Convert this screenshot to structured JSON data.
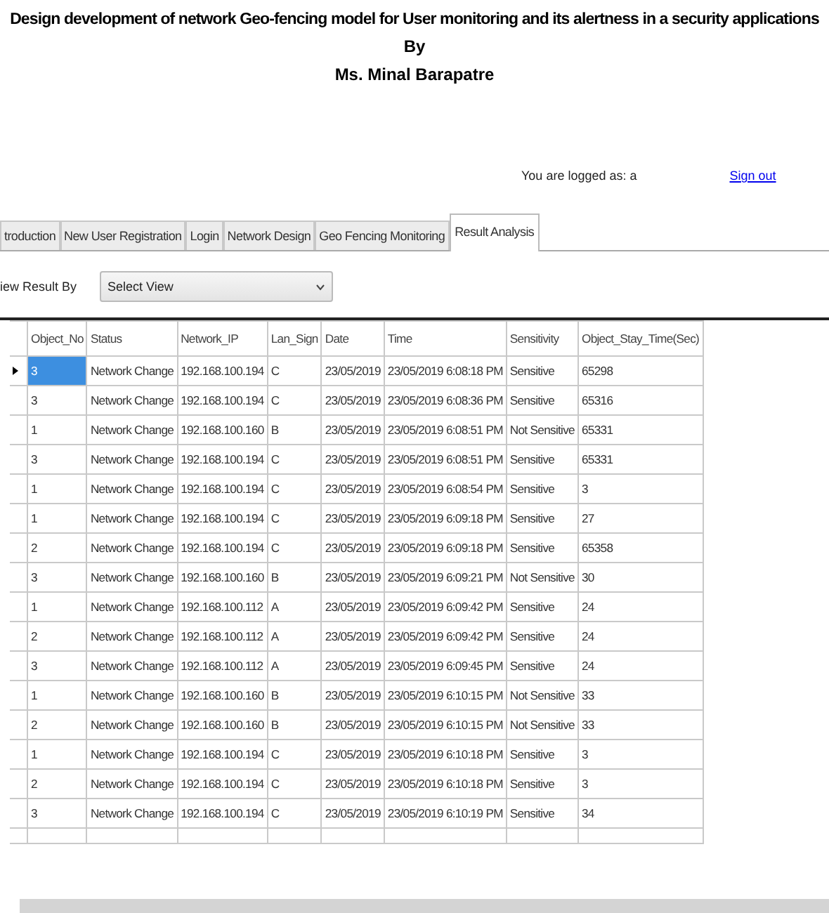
{
  "header": {
    "title": "Design  development of network Geo-fencing model for User monitoring and its alertness in a security applications",
    "by": "By",
    "author": "Ms. Minal Barapatre"
  },
  "user_bar": {
    "logged_as": "You are logged as: a",
    "sign_out": "Sign out"
  },
  "tabs": [
    {
      "label": "troduction",
      "selected": false
    },
    {
      "label": "New User Registration",
      "selected": false
    },
    {
      "label": "Login",
      "selected": false
    },
    {
      "label": "Network Design",
      "selected": false
    },
    {
      "label": "Geo Fencing Monitoring",
      "selected": false
    },
    {
      "label": "Result Analysis",
      "selected": true
    }
  ],
  "view_filter": {
    "label": "iew Result By",
    "value": "Select View"
  },
  "table": {
    "columns": [
      "Object_No",
      "Status",
      "Network_IP",
      "Lan_Sign",
      "Date",
      "Time",
      "Sensitivity",
      "Object_Stay_Time(Sec)"
    ],
    "rows": [
      {
        "selected": true,
        "cells": [
          "3",
          "Network Change",
          "192.168.100.194",
          "C",
          "23/05/2019",
          "23/05/2019 6:08:18 PM",
          "Sensitive",
          "65298"
        ]
      },
      {
        "selected": false,
        "cells": [
          "3",
          "Network Change",
          "192.168.100.194",
          "C",
          "23/05/2019",
          "23/05/2019 6:08:36 PM",
          "Sensitive",
          "65316"
        ]
      },
      {
        "selected": false,
        "cells": [
          "1",
          "Network Change",
          "192.168.100.160",
          "B",
          "23/05/2019",
          "23/05/2019 6:08:51 PM",
          "Not Sensitive",
          "65331"
        ]
      },
      {
        "selected": false,
        "cells": [
          "3",
          "Network Change",
          "192.168.100.194",
          "C",
          "23/05/2019",
          "23/05/2019 6:08:51 PM",
          "Sensitive",
          "65331"
        ]
      },
      {
        "selected": false,
        "cells": [
          "1",
          "Network Change",
          "192.168.100.194",
          "C",
          "23/05/2019",
          "23/05/2019 6:08:54 PM",
          "Sensitive",
          "3"
        ]
      },
      {
        "selected": false,
        "cells": [
          "1",
          "Network Change",
          "192.168.100.194",
          "C",
          "23/05/2019",
          "23/05/2019 6:09:18 PM",
          "Sensitive",
          "27"
        ]
      },
      {
        "selected": false,
        "cells": [
          "2",
          "Network Change",
          "192.168.100.194",
          "C",
          "23/05/2019",
          "23/05/2019 6:09:18 PM",
          "Sensitive",
          "65358"
        ]
      },
      {
        "selected": false,
        "cells": [
          "3",
          "Network Change",
          "192.168.100.160",
          "B",
          "23/05/2019",
          "23/05/2019 6:09:21 PM",
          "Not Sensitive",
          "30"
        ]
      },
      {
        "selected": false,
        "cells": [
          "1",
          "Network Change",
          "192.168.100.112",
          "A",
          "23/05/2019",
          "23/05/2019 6:09:42 PM",
          "Sensitive",
          "24"
        ]
      },
      {
        "selected": false,
        "cells": [
          "2",
          "Network Change",
          "192.168.100.112",
          "A",
          "23/05/2019",
          "23/05/2019 6:09:42 PM",
          "Sensitive",
          "24"
        ]
      },
      {
        "selected": false,
        "cells": [
          "3",
          "Network Change",
          "192.168.100.112",
          "A",
          "23/05/2019",
          "23/05/2019 6:09:45 PM",
          "Sensitive",
          "24"
        ]
      },
      {
        "selected": false,
        "cells": [
          "1",
          "Network Change",
          "192.168.100.160",
          "B",
          "23/05/2019",
          "23/05/2019 6:10:15 PM",
          "Not Sensitive",
          "33"
        ]
      },
      {
        "selected": false,
        "cells": [
          "2",
          "Network Change",
          "192.168.100.160",
          "B",
          "23/05/2019",
          "23/05/2019 6:10:15 PM",
          "Not Sensitive",
          "33"
        ]
      },
      {
        "selected": false,
        "cells": [
          "1",
          "Network Change",
          "192.168.100.194",
          "C",
          "23/05/2019",
          "23/05/2019 6:10:18 PM",
          "Sensitive",
          "3"
        ]
      },
      {
        "selected": false,
        "cells": [
          "2",
          "Network Change",
          "192.168.100.194",
          "C",
          "23/05/2019",
          "23/05/2019 6:10:18 PM",
          "Sensitive",
          "3"
        ]
      },
      {
        "selected": false,
        "cells": [
          "3",
          "Network Change",
          "192.168.100.194",
          "C",
          "23/05/2019",
          "23/05/2019 6:10:19 PM",
          "Sensitive",
          "34"
        ]
      }
    ]
  }
}
